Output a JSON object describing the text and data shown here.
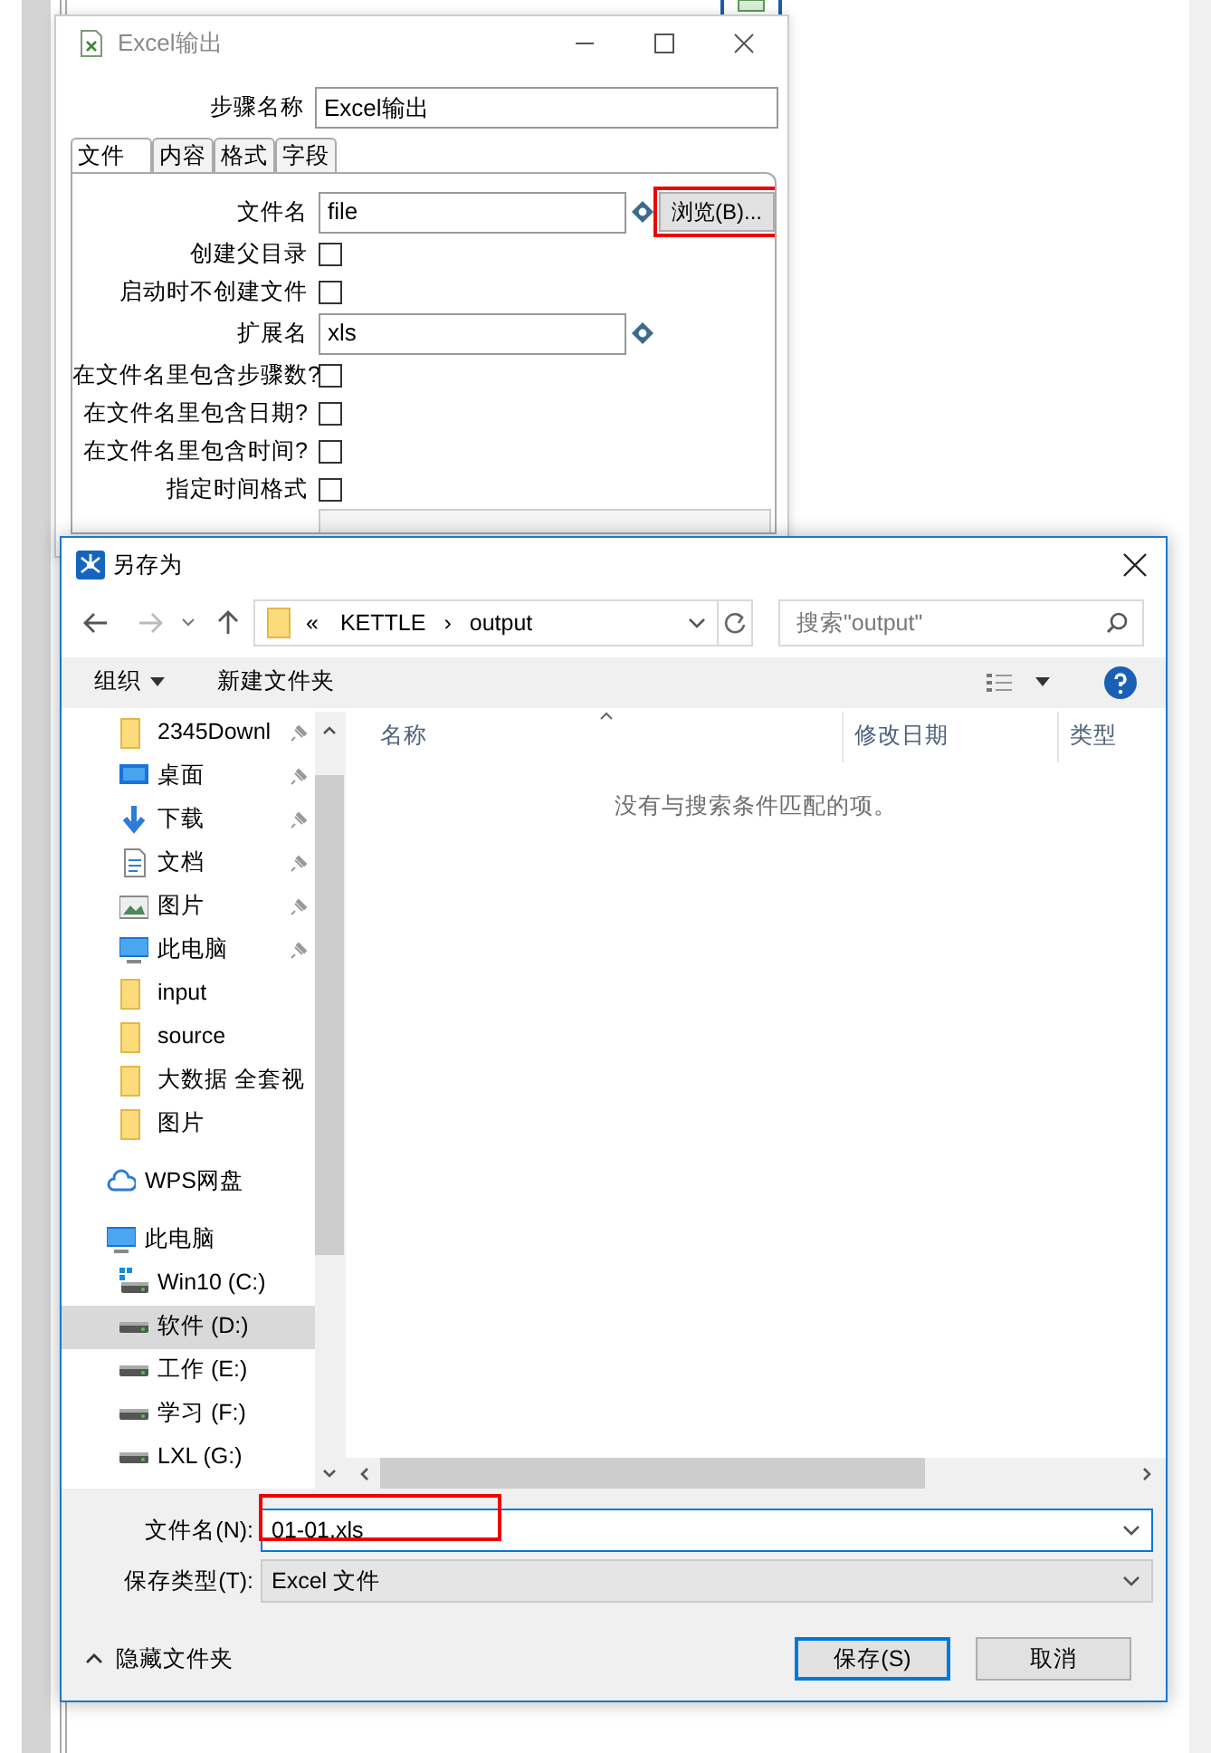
{
  "background_window": {
    "title": "Excel输出",
    "step_name_label": "步骤名称",
    "step_name": "Excel输出",
    "tabs": [
      {
        "label": "文件",
        "selected": true
      },
      {
        "label": "内容",
        "selected": false
      },
      {
        "label": "格式",
        "selected": false
      },
      {
        "label": "字段",
        "selected": false
      }
    ],
    "fields": [
      {
        "kind": "text",
        "label": "文件名",
        "value": "file",
        "button": "浏览(B)...",
        "highlighted": true
      },
      {
        "kind": "checkbox",
        "label": "创建父目录",
        "checked": false
      },
      {
        "kind": "checkbox",
        "label": "启动时不创建文件",
        "checked": false
      },
      {
        "kind": "text",
        "label": "扩展名",
        "value": "xls"
      },
      {
        "kind": "checkbox",
        "label": "在文件名里包含步骤数?",
        "checked": false
      },
      {
        "kind": "checkbox",
        "label": "在文件名里包含日期?",
        "checked": false
      },
      {
        "kind": "checkbox",
        "label": "在文件名里包含时间?",
        "checked": false
      },
      {
        "kind": "checkbox",
        "label": "指定时间格式",
        "checked": false
      },
      {
        "kind": "select"
      }
    ]
  },
  "save_dialog": {
    "title": "另存为",
    "path_overflow": "«",
    "path": [
      "KETTLE",
      "output"
    ],
    "path_separator": "›",
    "search": {
      "placeholder": "搜索\"output\""
    },
    "toolbar": {
      "organize": "组织",
      "new_folder": "新建文件夹"
    },
    "nav_items": [
      {
        "label": "2345Downl",
        "kind": "folder",
        "pinned": true,
        "selected": false
      },
      {
        "label": "桌面",
        "kind": "desktop",
        "pinned": true,
        "selected": false
      },
      {
        "label": "下载",
        "kind": "download",
        "pinned": true,
        "selected": false
      },
      {
        "label": "文档",
        "kind": "document",
        "pinned": true,
        "selected": false
      },
      {
        "label": "图片",
        "kind": "picture",
        "pinned": true,
        "selected": false
      },
      {
        "label": "此电脑",
        "kind": "computer",
        "pinned": true,
        "selected": false
      },
      {
        "label": "input",
        "kind": "folder",
        "pinned": false,
        "selected": false
      },
      {
        "label": "source",
        "kind": "folder",
        "pinned": false,
        "selected": false
      },
      {
        "label": "大数据 全套视",
        "kind": "folder",
        "pinned": false,
        "selected": false
      },
      {
        "label": "图片",
        "kind": "folder",
        "pinned": false,
        "selected": false
      }
    ],
    "locations": [
      {
        "label": "WPS网盘",
        "kind": "cloud",
        "selected": false
      },
      {
        "label": "此电脑",
        "kind": "computer",
        "selected": false,
        "children": [
          {
            "label": "Win10 (C:)",
            "kind": "system-drive",
            "selected": false
          },
          {
            "label": "软件 (D:)",
            "kind": "drive",
            "selected": true
          },
          {
            "label": "工作 (E:)",
            "kind": "drive",
            "selected": false
          },
          {
            "label": "学习 (F:)",
            "kind": "drive",
            "selected": false
          },
          {
            "label": "LXL (G:)",
            "kind": "drive",
            "selected": false
          }
        ]
      }
    ],
    "columns": [
      "名称",
      "修改日期",
      "类型"
    ],
    "empty_message": "没有与搜索条件匹配的项。",
    "file_name_label": "文件名(N):",
    "file_name": "01-01.xls",
    "file_name_highlighted": true,
    "file_type_label": "保存类型(T):",
    "file_type": "Excel 文件",
    "hide_folders": "隐藏文件夹",
    "buttons": [
      {
        "label": "保存(S)",
        "default": true
      },
      {
        "label": "取消",
        "default": false
      }
    ]
  }
}
